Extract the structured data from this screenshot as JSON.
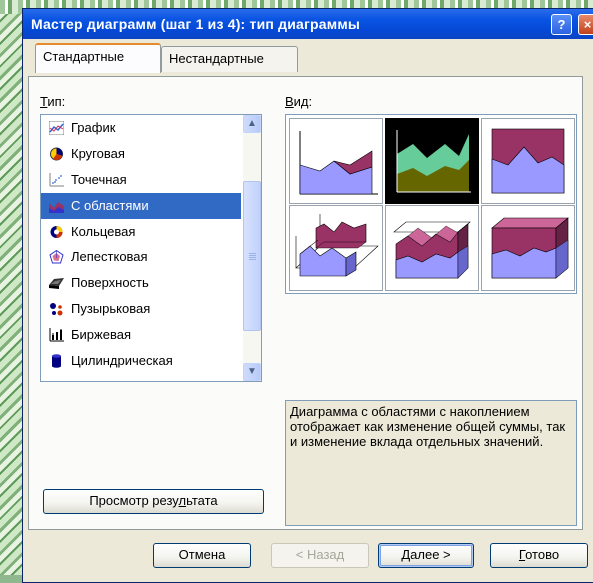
{
  "window": {
    "title": "Мастер диаграмм (шаг 1 из 4): тип диаграммы",
    "help": "?",
    "close": "×"
  },
  "tabs": [
    {
      "label": "Стандартные",
      "active": true
    },
    {
      "label": "Нестандартные",
      "active": false
    }
  ],
  "type_label": {
    "accel": "Т",
    "rest": "ип:"
  },
  "view_label": {
    "accel": "В",
    "rest": "ид:"
  },
  "chart_types": [
    {
      "label": "График",
      "icon": "line-chart-icon"
    },
    {
      "label": "Круговая",
      "icon": "pie-chart-icon"
    },
    {
      "label": "Точечная",
      "icon": "scatter-chart-icon"
    },
    {
      "label": "С областями",
      "icon": "area-chart-icon",
      "selected": true
    },
    {
      "label": "Кольцевая",
      "icon": "doughnut-chart-icon"
    },
    {
      "label": "Лепестковая",
      "icon": "radar-chart-icon"
    },
    {
      "label": "Поверхность",
      "icon": "surface-chart-icon"
    },
    {
      "label": "Пузырьковая",
      "icon": "bubble-chart-icon"
    },
    {
      "label": "Биржевая",
      "icon": "stock-chart-icon"
    },
    {
      "label": "Цилиндрическая",
      "icon": "cylinder-chart-icon"
    }
  ],
  "subtype_icons": [
    "area-subtype-icon",
    "stacked-area-subtype-icon",
    "100-percent-stacked-area-subtype-icon",
    "3d-area-subtype-icon",
    "3d-stacked-area-subtype-icon",
    "3d-100-percent-stacked-area-subtype-icon"
  ],
  "selected_subtype": 1,
  "colors": {
    "area_blue": "#9999ff",
    "area_purple": "#993366",
    "area_mint": "#66cc99",
    "area_olive": "#666600",
    "selection": "#316ac5"
  },
  "description": "Диаграмма с областями с накоплением отображает как изменение общей суммы, так и изменение вклада отдельных значений.",
  "buttons": {
    "preview": {
      "before": "Просмотр резу",
      "accel": "л",
      "after": "ьтата"
    },
    "cancel": "Отмена",
    "back": "< Назад",
    "next": {
      "accel": "Д",
      "after": "алее >"
    },
    "finish": {
      "accel": "Г",
      "after": "отово"
    }
  }
}
